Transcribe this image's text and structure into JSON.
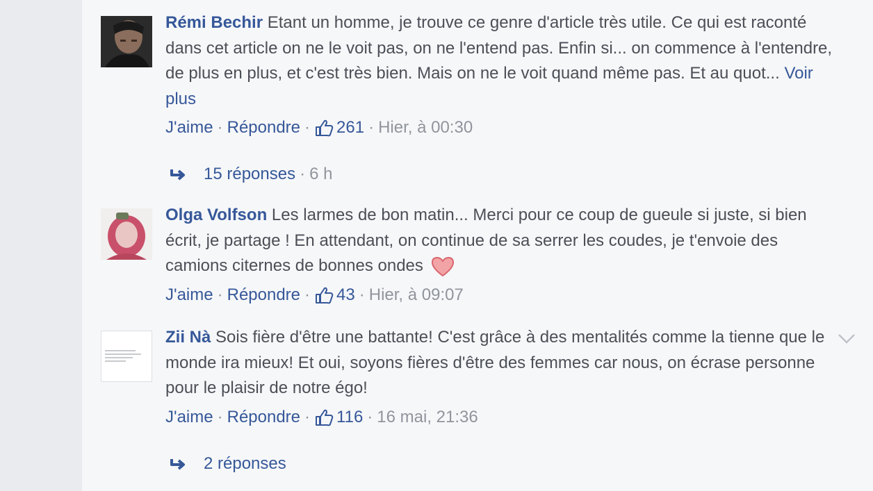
{
  "colors": {
    "link": "#365899",
    "text": "#4b4f56",
    "meta": "#90949c",
    "bg": "#f6f7f9"
  },
  "comments": [
    {
      "author": "Rémi Bechir",
      "text": "Etant un homme, je trouve ce genre d'article très utile. Ce qui est raconté dans cet article on ne le voit pas, on ne l'entend pas. Enfin si... on commence à l'entendre, de plus en plus, et c'est très bien. Mais on ne le voit quand même pas. Et au quot...",
      "see_more": "Voir plus",
      "like": "J'aime",
      "reply": "Répondre",
      "likes": "261",
      "time": "Hier, à 00:30",
      "replies_label": "15 réponses",
      "replies_time": "6 h",
      "avatar_icon": "person-photo"
    },
    {
      "author": "Olga Volfson",
      "text": "Les larmes de bon matin... Merci pour ce coup de gueule si juste, si bien écrit, je partage ! En attendant, on continue de sa serrer les coudes, je t'envoie des camions citernes de bonnes ondes",
      "like": "J'aime",
      "reply": "Répondre",
      "likes": "43",
      "time": "Hier, à 09:07",
      "emoji_icon": "heart-icon",
      "avatar_icon": "person-photo"
    },
    {
      "author": "Zii Nà",
      "text": "Sois fière d'être une battante! C'est grâce à des mentalités comme la tienne que le monde ira mieux! Et oui, soyons fières d'être des femmes car nous, on écrase personne pour le plaisir de notre égo!",
      "like": "J'aime",
      "reply": "Répondre",
      "likes": "116",
      "time": "16 mai, 21:36",
      "replies_label": "2 réponses",
      "avatar_icon": "text-image"
    }
  ],
  "separator": "·"
}
